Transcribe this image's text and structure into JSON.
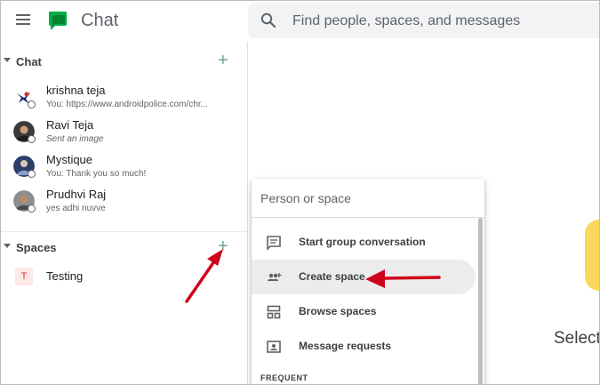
{
  "app": {
    "title": "Chat"
  },
  "search": {
    "placeholder": "Find people, spaces, and messages"
  },
  "sidebar": {
    "chat_section": {
      "label": "Chat",
      "items": [
        {
          "name": "krishna teja",
          "preview": "You: https://www.androidpolice.com/chr...",
          "italic": false
        },
        {
          "name": "Ravi Teja",
          "preview": "Sent an image",
          "italic": true
        },
        {
          "name": "Mystique",
          "preview": "You: Thank you so much!",
          "italic": false
        },
        {
          "name": "Prudhvi Raj",
          "preview": "yes adhi nuvve",
          "italic": false
        }
      ]
    },
    "spaces_section": {
      "label": "Spaces",
      "items": [
        {
          "initial": "T",
          "name": "Testing"
        }
      ]
    }
  },
  "popup": {
    "input_placeholder": "Person or space",
    "items": [
      {
        "label": "Start group conversation",
        "icon": "message-icon"
      },
      {
        "label": "Create space",
        "icon": "group-add-icon"
      },
      {
        "label": "Browse spaces",
        "icon": "browse-spaces-icon"
      },
      {
        "label": "Message requests",
        "icon": "contact-card-icon"
      }
    ],
    "frequent_label": "FREQUENT"
  },
  "main": {
    "select_text": "Select"
  },
  "colors": {
    "accent_green": "#00ac47",
    "plus_green": "#6aa58b",
    "annotation_red": "#d0021b"
  }
}
